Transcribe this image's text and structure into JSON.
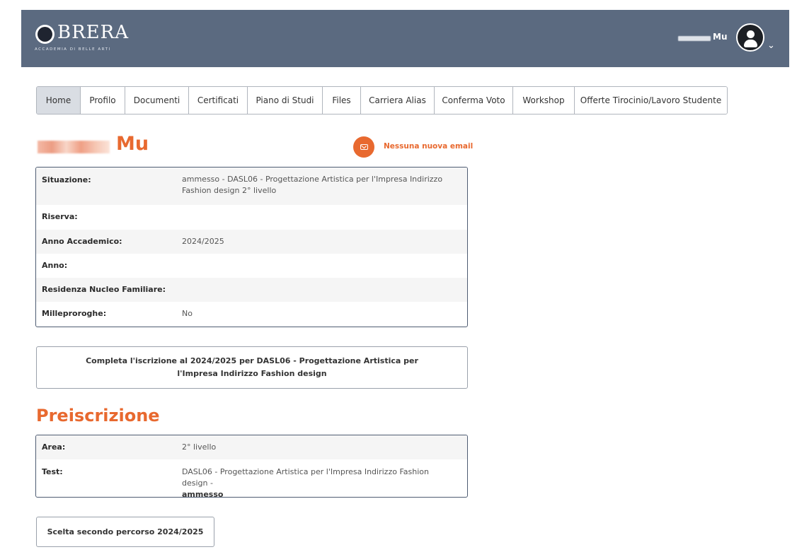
{
  "header": {
    "logo_text": "BRERA",
    "logo_sub": "ACCADEMIA DI BELLE ARTI",
    "user_name": "Mu"
  },
  "tabs": [
    {
      "label": "Home",
      "active": true
    },
    {
      "label": "Profilo"
    },
    {
      "label": "Documenti"
    },
    {
      "label": "Certificati"
    },
    {
      "label": "Piano di Studi"
    },
    {
      "label": "Files"
    },
    {
      "label": "Carriera Alias"
    },
    {
      "label": "Conferma Voto"
    },
    {
      "label": "Workshop"
    },
    {
      "label": "Offerte Tirocinio/Lavoro Studente"
    }
  ],
  "student": {
    "name": "Mu",
    "mail_status": "Nessuna nuova email"
  },
  "situation": {
    "rows": [
      {
        "label": "Situazione:",
        "value": "ammesso - DASL06 - Progettazione Artistica per l'Impresa Indirizzo Fashion design 2° livello"
      },
      {
        "label": "Riserva:",
        "value": ""
      },
      {
        "label": "Anno Accademico:",
        "value": "2024/2025"
      },
      {
        "label": "Anno:",
        "value": ""
      },
      {
        "label": "Residenza Nucleo Familiare:",
        "value": ""
      },
      {
        "label": "Milleproroghe:",
        "value": "No"
      }
    ]
  },
  "enrollment_button": "Completa l'iscrizione al 2024/2025 per DASL06 - Progettazione Artistica per l'Impresa Indirizzo Fashion design",
  "preiscrizione": {
    "title": "Preiscrizione",
    "rows": [
      {
        "label": "Area:",
        "value": "2° livello"
      },
      {
        "label": "Test:",
        "value": "DASL06 - Progettazione Artistica per l'Impresa Indirizzo Fashion design -",
        "value_strong": "ammesso"
      }
    ]
  },
  "second_path_button": "Scelta secondo percorso 2024/2025"
}
